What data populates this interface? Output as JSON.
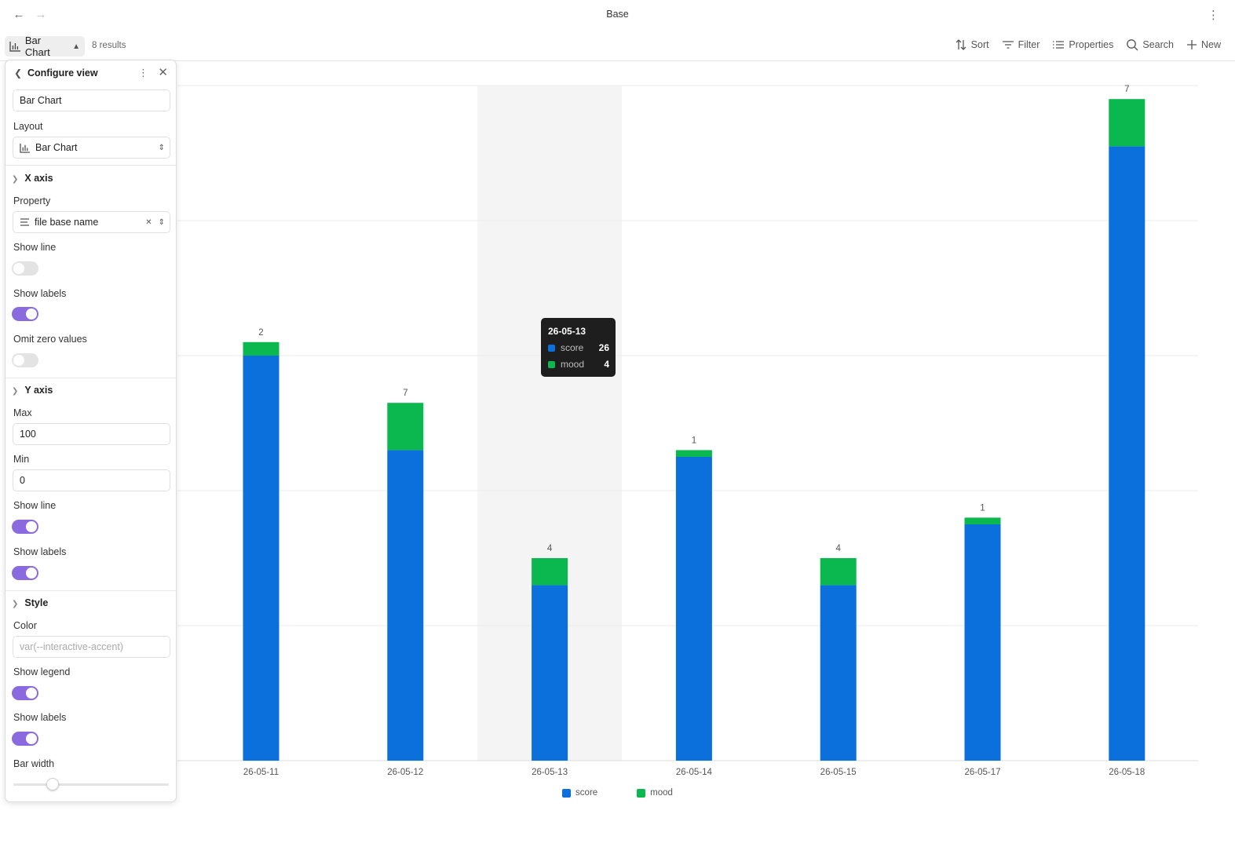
{
  "window": {
    "title": "Base"
  },
  "toolbar": {
    "view_label": "Bar Chart",
    "results": "8 results",
    "sort": "Sort",
    "filter": "Filter",
    "properties": "Properties",
    "search": "Search",
    "new": "New"
  },
  "panel": {
    "title": "Configure view",
    "view_name": "Bar Chart",
    "layout_label": "Layout",
    "layout_value": "Bar Chart",
    "x_axis": {
      "heading": "X axis",
      "property_label": "Property",
      "property_value": "file base name",
      "show_line_label": "Show line",
      "show_line": false,
      "show_labels_label": "Show labels",
      "show_labels": true,
      "omit_zero_label": "Omit zero values",
      "omit_zero": false
    },
    "y_axis": {
      "heading": "Y axis",
      "max_label": "Max",
      "max_value": "100",
      "min_label": "Min",
      "min_value": "0",
      "show_line_label": "Show line",
      "show_line": true,
      "show_labels_label": "Show labels",
      "show_labels": true
    },
    "style": {
      "heading": "Style",
      "color_label": "Color",
      "color_placeholder": "var(--interactive-accent)",
      "show_legend_label": "Show legend",
      "show_legend": true,
      "show_labels_label": "Show labels",
      "show_labels": true,
      "bar_width_label": "Bar width",
      "bar_width_fraction": 0.25
    }
  },
  "chart_data": {
    "type": "bar",
    "stacked": true,
    "categories": [
      "26-05-11",
      "26-05-12",
      "26-05-13",
      "26-05-14",
      "26-05-15",
      "26-05-17",
      "26-05-18"
    ],
    "series": [
      {
        "name": "score",
        "color": "#0b6fdc",
        "values": [
          60,
          46,
          26,
          45,
          26,
          35,
          91
        ]
      },
      {
        "name": "mood",
        "color": "#0bb84f",
        "values": [
          2,
          7,
          4,
          1,
          4,
          1,
          7
        ]
      }
    ],
    "data_labels": [
      "2",
      "7",
      "4",
      "1",
      "4",
      "1",
      "7"
    ],
    "ylim": [
      0,
      100
    ],
    "grid": true,
    "legend": "bottom",
    "highlighted_category": "26-05-13"
  },
  "tooltip": {
    "title": "26-05-13",
    "rows": [
      {
        "name": "score",
        "value": "26",
        "color": "#0b6fdc"
      },
      {
        "name": "mood",
        "value": "4",
        "color": "#0bb84f"
      }
    ]
  },
  "legend": [
    {
      "name": "score",
      "color": "#0b6fdc"
    },
    {
      "name": "mood",
      "color": "#0bb84f"
    }
  ]
}
